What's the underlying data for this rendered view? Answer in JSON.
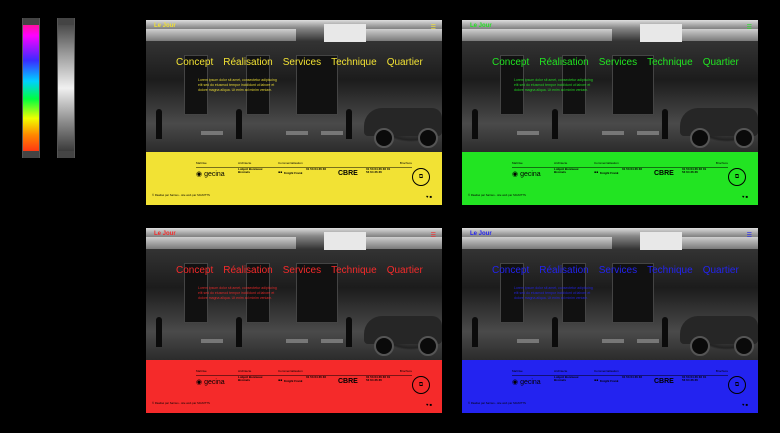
{
  "swatches": {
    "color_bar": "color-gradient",
    "gray_bar": "gray-gradient"
  },
  "brand_name": "Le Jour",
  "nav_items": [
    "Concept",
    "Réalisation",
    "Services",
    "Technique",
    "Quartier"
  ],
  "body_text": "Lorem ipsum dolor sit amet, consectetur adipiscing elit sed do eiusmod tempor incididunt ut labore et dolore magna aliqua. Ut enim ad minim veniam.",
  "footer": {
    "label_1": "Maîtrise",
    "label_2": "Architecte",
    "label_3": "Commercialisation",
    "label_4": "Ville",
    "gecina": "gecina",
    "architect": "Lobjoit Bonnieux Bromels",
    "bnp": "Knight Frank",
    "cbre": "CBRE",
    "cbre_detail": "01 53 64 36 36 01 53 64 36 36",
    "phone": "01 53 64 36 36",
    "doc_label": "Brochure",
    "doc_icon": "document-icon",
    "copyright": "© Réalisé par Sarries - site web par SIGNITTS",
    "social": "♥ ■"
  },
  "panels": [
    {
      "id": "yellow",
      "accent": "#f2e234"
    },
    {
      "id": "green",
      "accent": "#22e422"
    },
    {
      "id": "red",
      "accent": "#f52a2a"
    },
    {
      "id": "blue",
      "accent": "#2323f0"
    }
  ]
}
